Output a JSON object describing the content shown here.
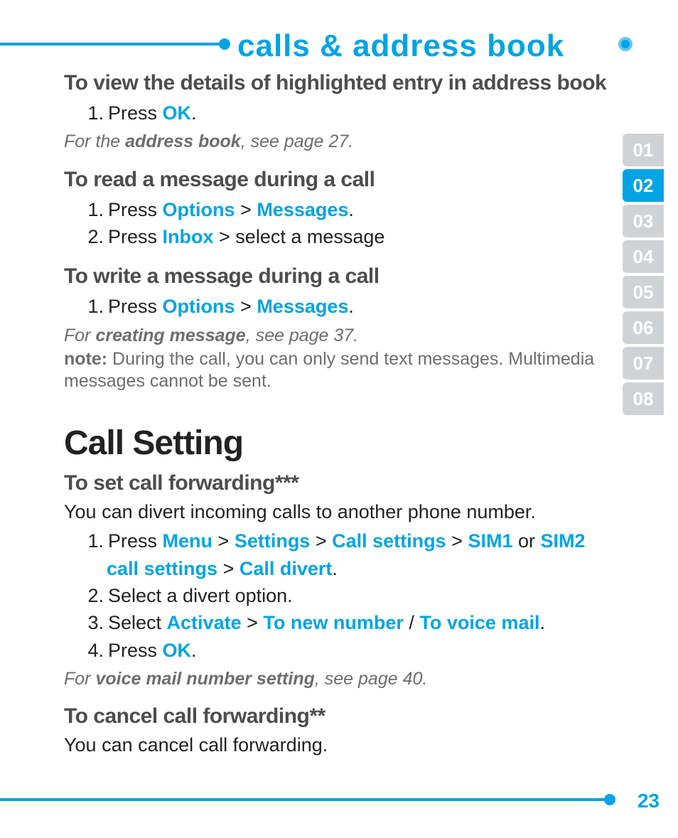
{
  "header": {
    "title": "calls & address book"
  },
  "tabs": [
    "01",
    "02",
    "03",
    "04",
    "05",
    "06",
    "07",
    "08"
  ],
  "active_tab_index": 1,
  "page_number": "23",
  "sections": {
    "view_details": {
      "heading": "To view the details of highlighted entry in address book",
      "step1_press": "Press ",
      "step1_ok": "OK",
      "step1_end": ".",
      "ref_pre": "For the ",
      "ref_bold": "address book",
      "ref_post": ", see page 27."
    },
    "read_msg": {
      "heading": "To read a message during a call",
      "s1_press": "Press ",
      "s1_a": "Options",
      "s1_gt": " > ",
      "s1_b": "Messages",
      "s1_end": ".",
      "s2_press": "Press ",
      "s2_a": "Inbox",
      "s2_post": " > select a message"
    },
    "write_msg": {
      "heading": "To write a message during a call",
      "s1_press": "Press ",
      "s1_a": "Options",
      "s1_gt": " > ",
      "s1_b": "Messages",
      "s1_end": ".",
      "ref_pre": "For ",
      "ref_bold": "creating message",
      "ref_post": ", see page 37.",
      "note_label": "note:",
      "note_body": " During the call, you can only send text messages. Multimedia messages cannot be sent."
    },
    "call_setting": {
      "heading": "Call Setting"
    },
    "set_fwd": {
      "heading": "To set call forwarding***",
      "intro": "You can divert incoming calls to another phone number.",
      "s1_press": "Press ",
      "s1_a": "Menu",
      "gt": " > ",
      "s1_b": "Settings",
      "s1_c": "Call settings",
      "s1_d": "SIM1",
      "s1_or": " or ",
      "s1_e": "SIM2 call settings",
      "s1_f": "Call divert",
      "s1_end": ".",
      "s2": "Select a divert option.",
      "s3_pre": "Select ",
      "s3_a": "Activate",
      "s3_b": "To new number",
      "s3_slash": " / ",
      "s3_c": "To voice mail",
      "s3_end": ".",
      "s4_press": "Press ",
      "s4_a": "OK",
      "s4_end": ".",
      "ref_pre": "For ",
      "ref_bold": "voice mail number setting",
      "ref_post": ", see page 40."
    },
    "cancel_fwd": {
      "heading": "To cancel call forwarding**",
      "intro": "You can cancel call forwarding."
    }
  }
}
